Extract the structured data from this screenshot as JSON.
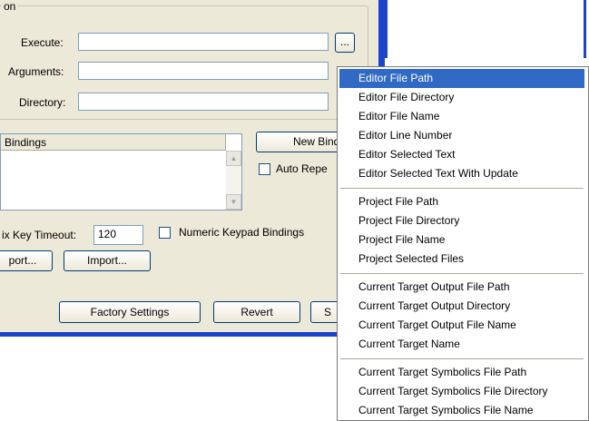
{
  "dialog": {
    "group_title": "on",
    "execute_label": "Execute:",
    "execute_value": "",
    "browse_label": "...",
    "arguments_label": "Arguments:",
    "arguments_value": "",
    "directory_label": "Directory:",
    "directory_value": "",
    "bindings_header": "Bindings",
    "new_binding_label": "New Bindi",
    "auto_repeat_label": "Auto Repe",
    "prefix_timeout_label": "ix Key Timeout:",
    "prefix_timeout_value": "120",
    "numeric_keypad_label": "Numeric Keypad Bindings",
    "export_label": "port...",
    "import_label": "Import...",
    "factory_settings_label": "Factory Settings",
    "revert_label": "Revert",
    "save_label": "S"
  },
  "menu": {
    "items": [
      "Editor File Path",
      "Editor File Directory",
      "Editor File Name",
      "Editor Line Number",
      "Editor Selected Text",
      "Editor Selected Text With Update",
      "Project File Path",
      "Project File Directory",
      "Project File Name",
      "Project Selected Files",
      "Current Target Output File Path",
      "Current Target Output Directory",
      "Current Target Output File Name",
      "Current Target Name",
      "Current Target Symbolics File Path",
      "Current Target Symbolics File Directory",
      "Current Target Symbolics File Name"
    ],
    "selected_index": 0
  },
  "colors": {
    "dialog_bg": "#ece9d8",
    "accent_blue": "#1a45c8",
    "menu_highlight": "#316ac5"
  }
}
